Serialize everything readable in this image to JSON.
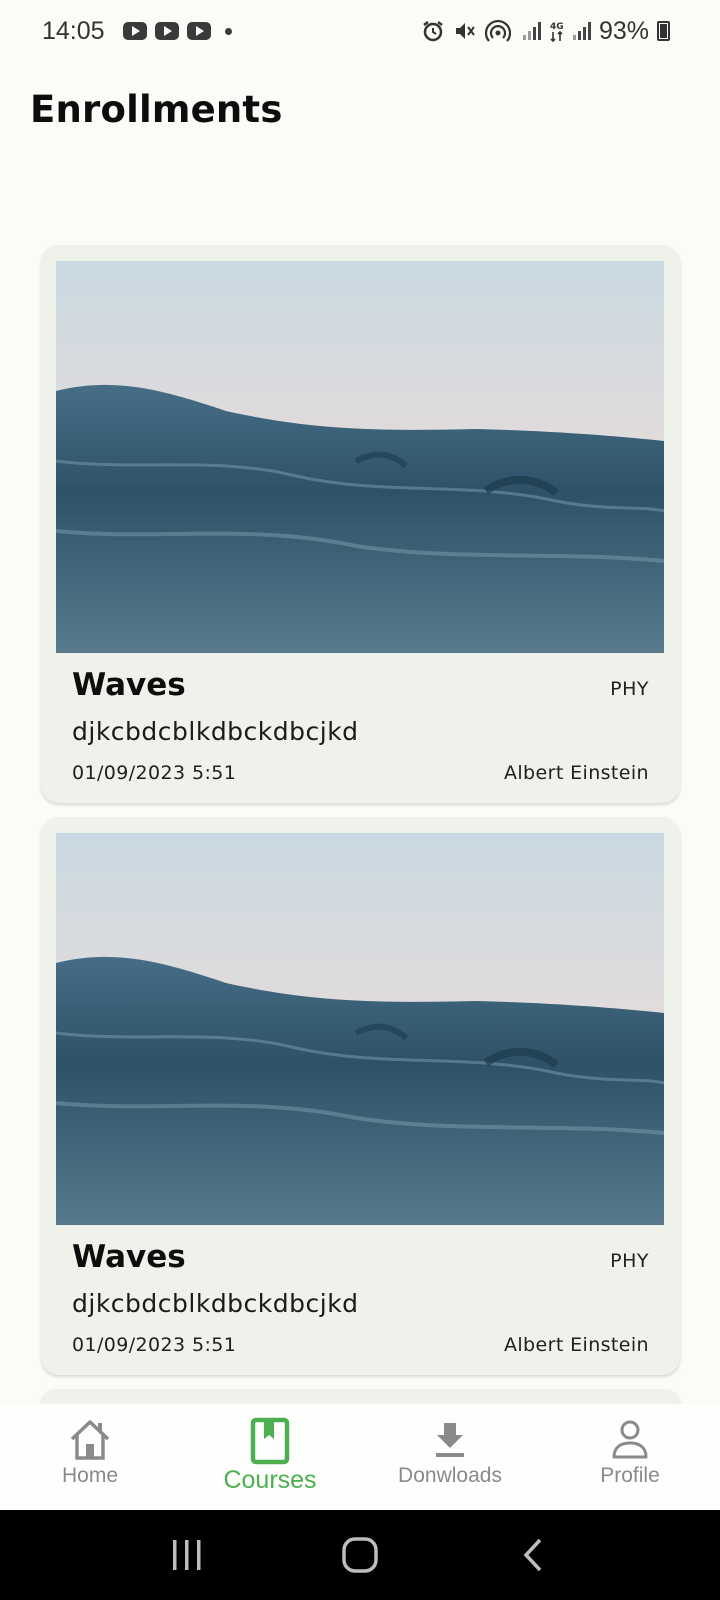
{
  "status": {
    "time": "14:05",
    "battery": "93%",
    "icons": [
      "youtube-icon",
      "youtube-icon",
      "youtube-icon",
      "notification-dot",
      "alarm-icon",
      "mute-icon",
      "hotspot-icon",
      "signal-icon",
      "4g-icon",
      "signal-icon",
      "battery-icon"
    ]
  },
  "page": {
    "title": "Enrollments"
  },
  "courses": [
    {
      "title": "Waves",
      "code": "PHY",
      "description": "djkcbdcblkdbckdbcjkd",
      "date": "01/09/2023 5:51",
      "instructor": "Albert Einstein"
    },
    {
      "title": "Waves",
      "code": "PHY",
      "description": "djkcbdcblkdbckdbcjkd",
      "date": "01/09/2023 5:51",
      "instructor": "Albert Einstein"
    }
  ],
  "nav": {
    "items": [
      {
        "label": "Home",
        "icon": "home-icon"
      },
      {
        "label": "Courses",
        "icon": "book-icon"
      },
      {
        "label": "Donwloads",
        "icon": "download-icon"
      },
      {
        "label": "Profile",
        "icon": "profile-icon"
      }
    ],
    "active": "Courses"
  },
  "colors": {
    "background": "#fbfcf7",
    "card": "#eef2ea",
    "accent": "#4caf50",
    "inactive": "#8a8a8a"
  }
}
